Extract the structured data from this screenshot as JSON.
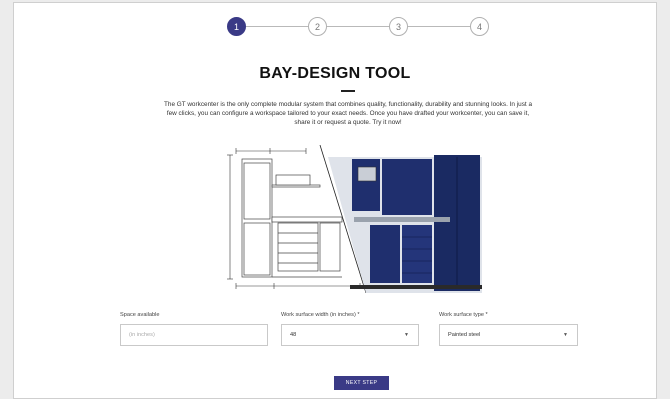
{
  "stepper": {
    "steps": [
      {
        "label": "1",
        "active": true
      },
      {
        "label": "2",
        "active": false
      },
      {
        "label": "3",
        "active": false
      },
      {
        "label": "4",
        "active": false
      }
    ]
  },
  "header": {
    "title": "BAY-DESIGN TOOL",
    "intro": "The GT workcenter is the only complete modular system that combines quality, functionality, durability and stunning looks. In just a few clicks, you can configure a workspace tailored to your exact needs. Once you have drafted your workcenter, you can save it, share it or request a quote. Try it now!"
  },
  "form": {
    "space_available": {
      "label": "Space available",
      "placeholder": "(in inches)",
      "value": ""
    },
    "surface_width": {
      "label": "Work surface width (in inches) *",
      "value": "48"
    },
    "surface_type": {
      "label": "Work surface type *",
      "value": "Painted steel"
    },
    "next_label": "NEXT STEP"
  },
  "colors": {
    "accent": "#3a3a86",
    "cabinet_blue": "#1f2f6e"
  },
  "icons": {
    "dropdown": "chevron-down-icon"
  }
}
